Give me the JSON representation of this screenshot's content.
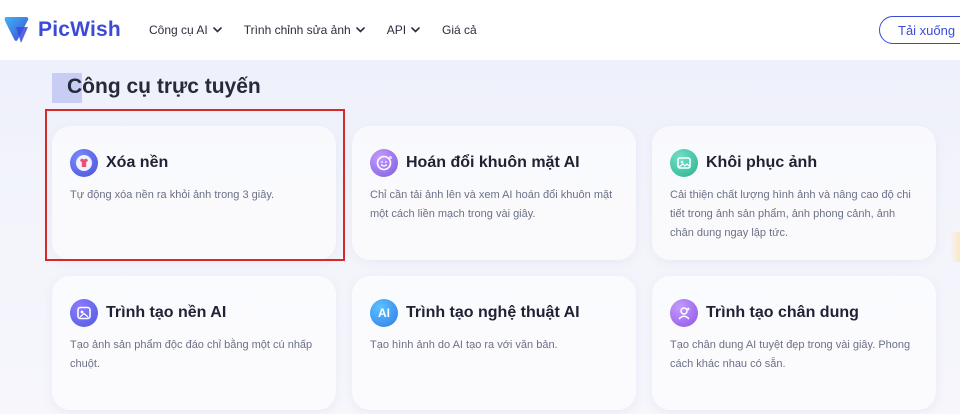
{
  "header": {
    "logo_text": "PicWish",
    "nav": [
      {
        "label": "Công cụ AI",
        "has_dropdown": true
      },
      {
        "label": "Trình chỉnh sửa ảnh",
        "has_dropdown": true
      },
      {
        "label": "API",
        "has_dropdown": true
      },
      {
        "label": "Giá cả",
        "has_dropdown": false
      }
    ],
    "download_label": "Tải xuống"
  },
  "section": {
    "title": "Công cụ trực tuyến"
  },
  "cards": [
    {
      "title": "Xóa nền",
      "description": "Tự động xóa nền ra khỏi ảnh trong 3 giây.",
      "icon": "tshirt-icon",
      "highlighted": true
    },
    {
      "title": "Hoán đổi khuôn mặt AI",
      "description": "Chỉ cần tải ảnh lên và xem AI hoán đổi khuôn mặt một cách liền mạch trong vài giây.",
      "icon": "face-swap-icon"
    },
    {
      "title": "Khôi phục ảnh",
      "description": "Cải thiện chất lượng hình ảnh và nâng cao độ chi tiết trong ảnh sản phẩm, ảnh phong cảnh, ảnh chân dung ngay lập tức.",
      "icon": "photo-restore-icon"
    },
    {
      "title": "Trình tạo nền AI",
      "description": "Tạo ảnh sản phẩm độc đáo chỉ bằng một cú nhấp chuột.",
      "icon": "background-generator-icon"
    },
    {
      "title": "Trình tạo nghệ thuật AI",
      "description": "Tạo hình ảnh do AI tạo ra với văn bản.",
      "icon": "ai-art-icon",
      "icon_text": "AI"
    },
    {
      "title": "Trình tạo chân dung",
      "description": "Tạo chân dung AI tuyệt đẹp trong vài giây. Phong cách khác nhau có sẵn.",
      "icon": "portrait-icon"
    }
  ],
  "colors": {
    "brand": "#3b4bd8",
    "highlight_border": "#d42a2a",
    "title_accent": "#c8cdf4"
  }
}
